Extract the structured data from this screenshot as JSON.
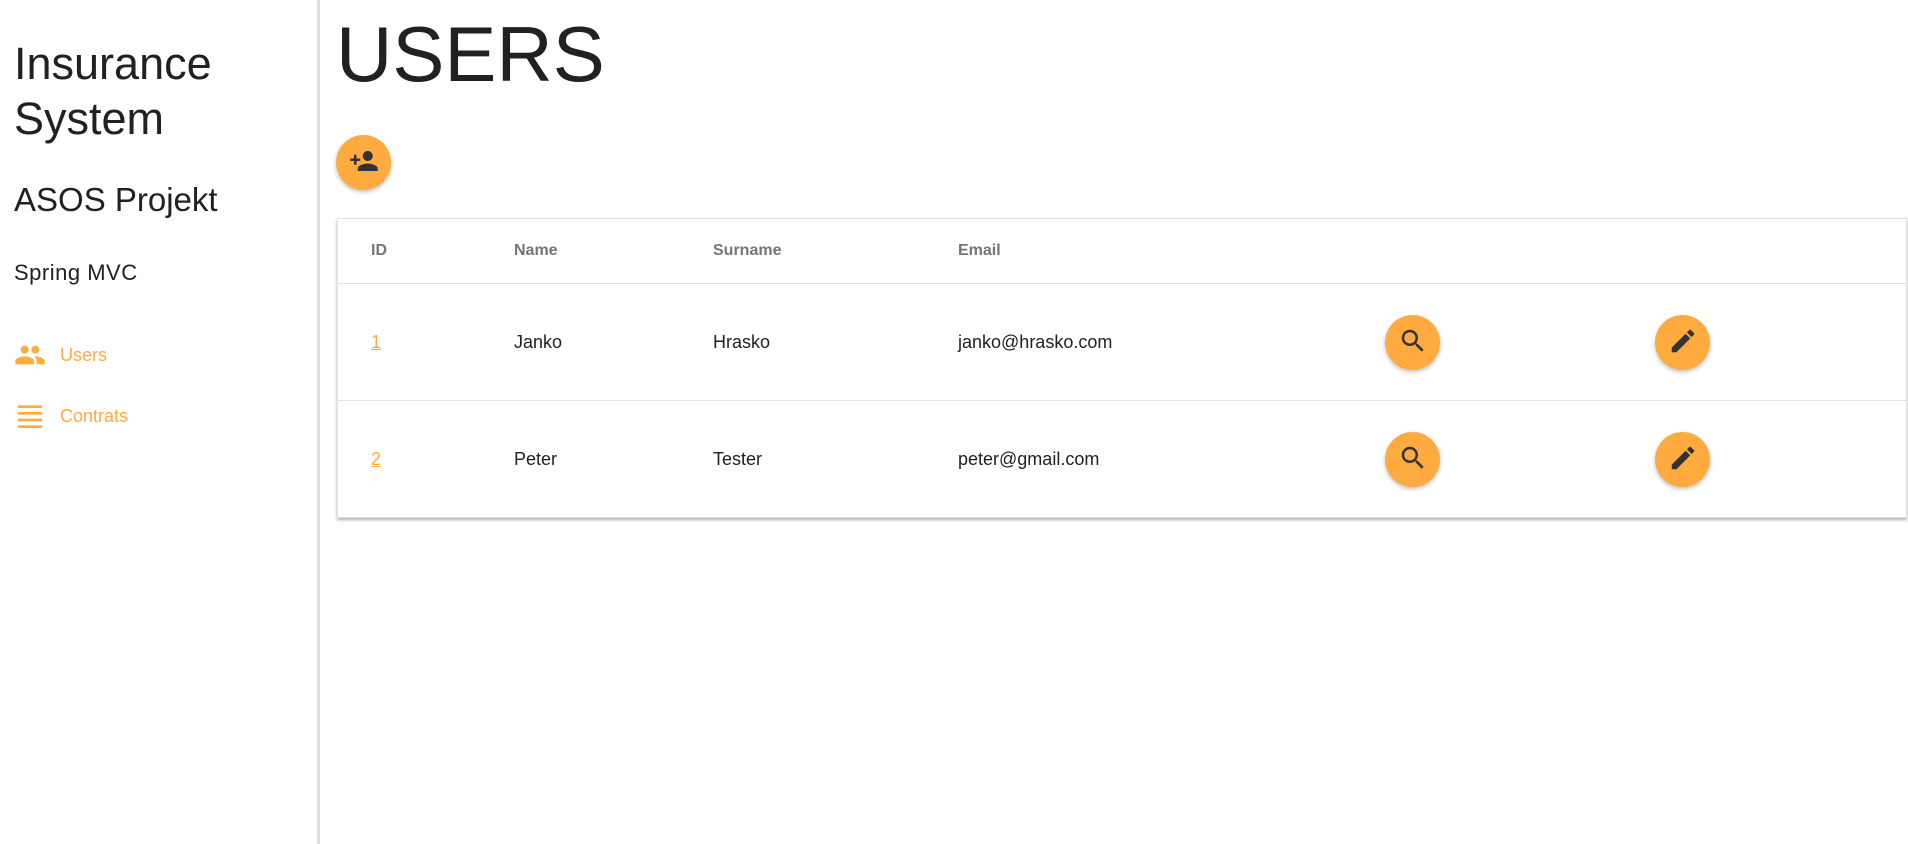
{
  "sidebar": {
    "app_title": "Insurance System",
    "project_title": "ASOS Projekt",
    "subtitle": "Spring MVC",
    "items": [
      {
        "label": "Users",
        "icon": "people-icon"
      },
      {
        "label": "Contrats",
        "icon": "list-icon"
      }
    ]
  },
  "main": {
    "title": "USERS",
    "add_button_icon": "person-add-icon",
    "table": {
      "headers": [
        "ID",
        "Name",
        "Surname",
        "Email"
      ],
      "rows": [
        {
          "id": "1",
          "name": "Janko",
          "surname": "Hrasko",
          "email": "janko@hrasko.com"
        },
        {
          "id": "2",
          "name": "Peter",
          "surname": "Tester",
          "email": "peter@gmail.com"
        }
      ],
      "row_actions": [
        "search-icon",
        "edit-icon"
      ]
    }
  },
  "colors": {
    "accent": "#ffab40",
    "text": "#212121",
    "header_text": "#757575",
    "divider": "#e0e0e0"
  }
}
